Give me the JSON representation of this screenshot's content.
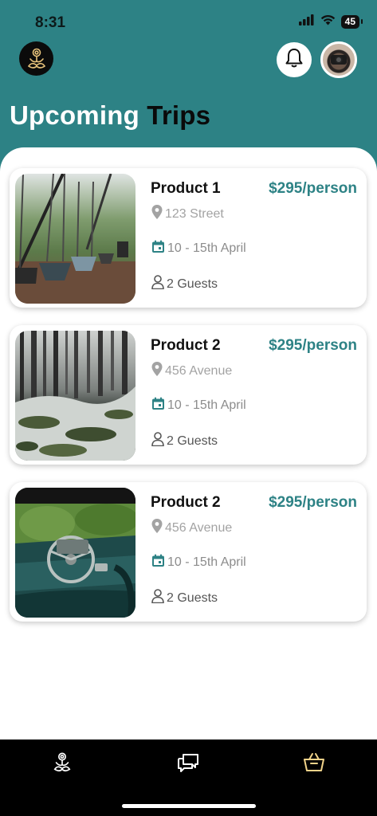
{
  "status_bar": {
    "time": "8:31",
    "battery": "45"
  },
  "header": {
    "title_part1": "Upcoming ",
    "title_part2": "Trips",
    "logo_icon": "meditation-logo-icon",
    "bell_icon": "bell-icon"
  },
  "trips": [
    {
      "title": "Product 1",
      "price": "$295/person",
      "address": "123 Street",
      "dates": "10 - 15th April",
      "guests": "2 Guests",
      "image": "playground-swings-photo"
    },
    {
      "title": "Product 2",
      "price": "$295/person",
      "address": "456 Avenue",
      "dates": "10 - 15th April",
      "guests": "2 Guests",
      "image": "snowy-forest-photo"
    },
    {
      "title": "Product 2",
      "price": "$295/person",
      "address": "456 Avenue",
      "dates": "10 - 15th April",
      "guests": "2 Guests",
      "image": "abandoned-car-interior-photo"
    }
  ],
  "tabbar": {
    "items": [
      {
        "icon": "meditation-home-icon",
        "active": false
      },
      {
        "icon": "chat-bubbles-icon",
        "active": false
      },
      {
        "icon": "basket-icon",
        "active": true
      }
    ]
  },
  "colors": {
    "brand": "#2d8285",
    "header_bg": "#2d8285",
    "active_tab": "#f2d38a"
  }
}
